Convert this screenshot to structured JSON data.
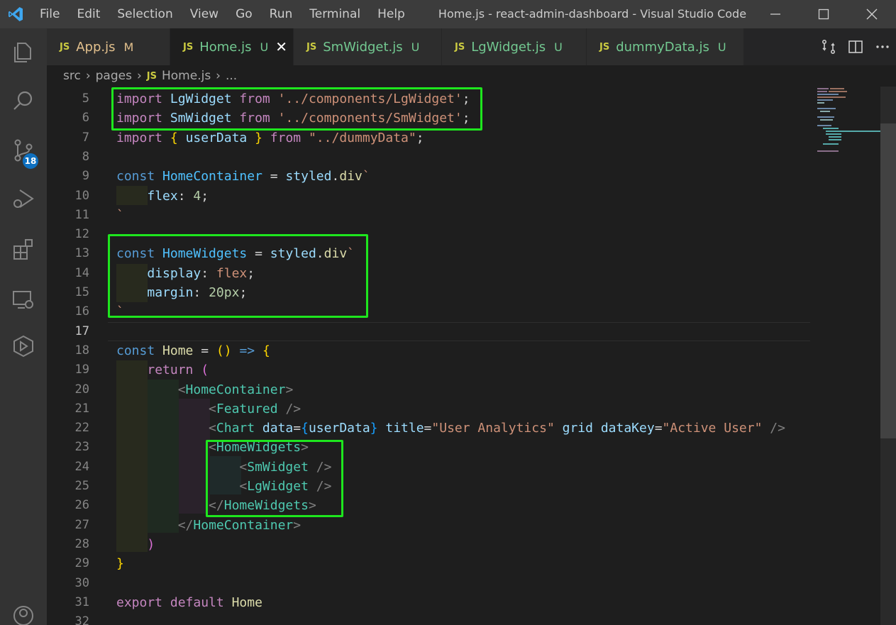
{
  "menu": [
    "File",
    "Edit",
    "Selection",
    "View",
    "Go",
    "Run",
    "Terminal",
    "Help"
  ],
  "window_title": "Home.js - react-admin-dashboard - Visual Studio Code",
  "activity": {
    "source_control_badge": "18"
  },
  "tabs": [
    {
      "name": "App.js",
      "status": "M"
    },
    {
      "name": "Home.js",
      "status": "U"
    },
    {
      "name": "SmWidget.js",
      "status": "U"
    },
    {
      "name": "LgWidget.js",
      "status": "U"
    },
    {
      "name": "dummyData.js",
      "status": "U"
    }
  ],
  "icons": {
    "file_type": "JS",
    "close": "✕"
  },
  "breadcrumb": {
    "parts": [
      "src",
      "pages",
      "Home.js",
      "..."
    ]
  },
  "editor": {
    "lines": [
      {
        "n": "5",
        "t": [
          [
            "kw",
            "import"
          ],
          [
            "pu",
            " "
          ],
          [
            "va",
            "LgWidget"
          ],
          [
            "pu",
            " "
          ],
          [
            "kw",
            "from"
          ],
          [
            "pu",
            " "
          ],
          [
            "st",
            "'../components/LgWidget'"
          ],
          [
            "pu",
            ";"
          ]
        ]
      },
      {
        "n": "6",
        "t": [
          [
            "kw",
            "import"
          ],
          [
            "pu",
            " "
          ],
          [
            "va",
            "SmWidget"
          ],
          [
            "pu",
            " "
          ],
          [
            "kw",
            "from"
          ],
          [
            "pu",
            " "
          ],
          [
            "st",
            "'../components/SmWidget'"
          ],
          [
            "pu",
            ";"
          ]
        ]
      },
      {
        "n": "7",
        "t": [
          [
            "kw",
            "import"
          ],
          [
            "pu",
            " "
          ],
          [
            "br1",
            "{"
          ],
          [
            "pu",
            " "
          ],
          [
            "va",
            "userData"
          ],
          [
            "pu",
            " "
          ],
          [
            "br1",
            "}"
          ],
          [
            "pu",
            " "
          ],
          [
            "kw",
            "from"
          ],
          [
            "pu",
            " "
          ],
          [
            "st",
            "\"../dummyData\""
          ],
          [
            "pu",
            ";"
          ]
        ]
      },
      {
        "n": "8",
        "t": []
      },
      {
        "n": "9",
        "t": [
          [
            "kw2",
            "const"
          ],
          [
            "pu",
            " "
          ],
          [
            "cn",
            "HomeContainer"
          ],
          [
            "pu",
            " = "
          ],
          [
            "va",
            "styled"
          ],
          [
            "pu",
            "."
          ],
          [
            "fn",
            "div"
          ],
          [
            "st",
            "`"
          ]
        ]
      },
      {
        "n": "10",
        "t": [
          [
            "pu",
            "    "
          ],
          [
            "va",
            "flex"
          ],
          [
            "pu",
            ": "
          ],
          [
            "nu",
            "4"
          ],
          [
            "pu",
            ";"
          ]
        ]
      },
      {
        "n": "11",
        "t": [
          [
            "st",
            "`"
          ]
        ]
      },
      {
        "n": "12",
        "t": []
      },
      {
        "n": "13",
        "t": [
          [
            "kw2",
            "const"
          ],
          [
            "pu",
            " "
          ],
          [
            "cn",
            "HomeWidgets"
          ],
          [
            "pu",
            " = "
          ],
          [
            "va",
            "styled"
          ],
          [
            "pu",
            "."
          ],
          [
            "fn",
            "div"
          ],
          [
            "st",
            "`"
          ]
        ]
      },
      {
        "n": "14",
        "t": [
          [
            "pu",
            "    "
          ],
          [
            "va",
            "display"
          ],
          [
            "pu",
            ": "
          ],
          [
            "st",
            "flex"
          ],
          [
            "pu",
            ";"
          ]
        ]
      },
      {
        "n": "15",
        "t": [
          [
            "pu",
            "    "
          ],
          [
            "va",
            "margin"
          ],
          [
            "pu",
            ": "
          ],
          [
            "nu",
            "20px"
          ],
          [
            "pu",
            ";"
          ]
        ]
      },
      {
        "n": "16",
        "t": [
          [
            "st",
            "`"
          ]
        ]
      },
      {
        "n": "17",
        "t": []
      },
      {
        "n": "18",
        "t": [
          [
            "kw2",
            "const"
          ],
          [
            "pu",
            " "
          ],
          [
            "fn",
            "Home"
          ],
          [
            "pu",
            " = "
          ],
          [
            "br1",
            "()"
          ],
          [
            "pu",
            " "
          ],
          [
            "kw2",
            "=>"
          ],
          [
            "pu",
            " "
          ],
          [
            "br1",
            "{"
          ]
        ]
      },
      {
        "n": "19",
        "t": [
          [
            "pu",
            "    "
          ],
          [
            "kw",
            "return"
          ],
          [
            "pu",
            " "
          ],
          [
            "br2",
            "("
          ]
        ]
      },
      {
        "n": "20",
        "t": [
          [
            "pu",
            "        "
          ],
          [
            "tg",
            "<"
          ],
          [
            "ty",
            "HomeContainer"
          ],
          [
            "tg",
            ">"
          ]
        ]
      },
      {
        "n": "21",
        "t": [
          [
            "pu",
            "            "
          ],
          [
            "tg",
            "<"
          ],
          [
            "ty",
            "Featured"
          ],
          [
            "pu",
            " "
          ],
          [
            "tg",
            "/>"
          ]
        ]
      },
      {
        "n": "22",
        "t": [
          [
            "pu",
            "            "
          ],
          [
            "tg",
            "<"
          ],
          [
            "ty",
            "Chart"
          ],
          [
            "pu",
            " "
          ],
          [
            "va",
            "data"
          ],
          [
            "pu",
            "="
          ],
          [
            "br3",
            "{"
          ],
          [
            "va",
            "userData"
          ],
          [
            "br3",
            "}"
          ],
          [
            "pu",
            " "
          ],
          [
            "va",
            "title"
          ],
          [
            "pu",
            "="
          ],
          [
            "st",
            "\"User Analytics\""
          ],
          [
            "pu",
            " "
          ],
          [
            "va",
            "grid"
          ],
          [
            "pu",
            " "
          ],
          [
            "va",
            "dataKey"
          ],
          [
            "pu",
            "="
          ],
          [
            "st",
            "\"Active User\""
          ],
          [
            "pu",
            " "
          ],
          [
            "tg",
            "/>"
          ]
        ]
      },
      {
        "n": "23",
        "t": [
          [
            "pu",
            "            "
          ],
          [
            "tg",
            "<"
          ],
          [
            "ty",
            "HomeWidgets"
          ],
          [
            "tg",
            ">"
          ]
        ]
      },
      {
        "n": "24",
        "t": [
          [
            "pu",
            "                "
          ],
          [
            "tg",
            "<"
          ],
          [
            "ty",
            "SmWidget"
          ],
          [
            "pu",
            " "
          ],
          [
            "tg",
            "/>"
          ]
        ]
      },
      {
        "n": "25",
        "t": [
          [
            "pu",
            "                "
          ],
          [
            "tg",
            "<"
          ],
          [
            "ty",
            "LgWidget"
          ],
          [
            "pu",
            " "
          ],
          [
            "tg",
            "/>"
          ]
        ]
      },
      {
        "n": "26",
        "t": [
          [
            "pu",
            "            "
          ],
          [
            "tg",
            "</"
          ],
          [
            "ty",
            "HomeWidgets"
          ],
          [
            "tg",
            ">"
          ]
        ]
      },
      {
        "n": "27",
        "t": [
          [
            "pu",
            "        "
          ],
          [
            "tg",
            "</"
          ],
          [
            "ty",
            "HomeContainer"
          ],
          [
            "tg",
            ">"
          ]
        ]
      },
      {
        "n": "28",
        "t": [
          [
            "pu",
            "    "
          ],
          [
            "br2",
            ")"
          ]
        ]
      },
      {
        "n": "29",
        "t": [
          [
            "br1",
            "}"
          ]
        ]
      },
      {
        "n": "30",
        "t": []
      },
      {
        "n": "31",
        "t": [
          [
            "kw",
            "export"
          ],
          [
            "pu",
            " "
          ],
          [
            "kw",
            "default"
          ],
          [
            "pu",
            " "
          ],
          [
            "fn",
            "Home"
          ]
        ]
      },
      {
        "n": "32",
        "t": []
      }
    ],
    "current_line": "17"
  },
  "colors": {
    "highlight_box": "#1ee61e",
    "accent": "#0e70c0"
  }
}
